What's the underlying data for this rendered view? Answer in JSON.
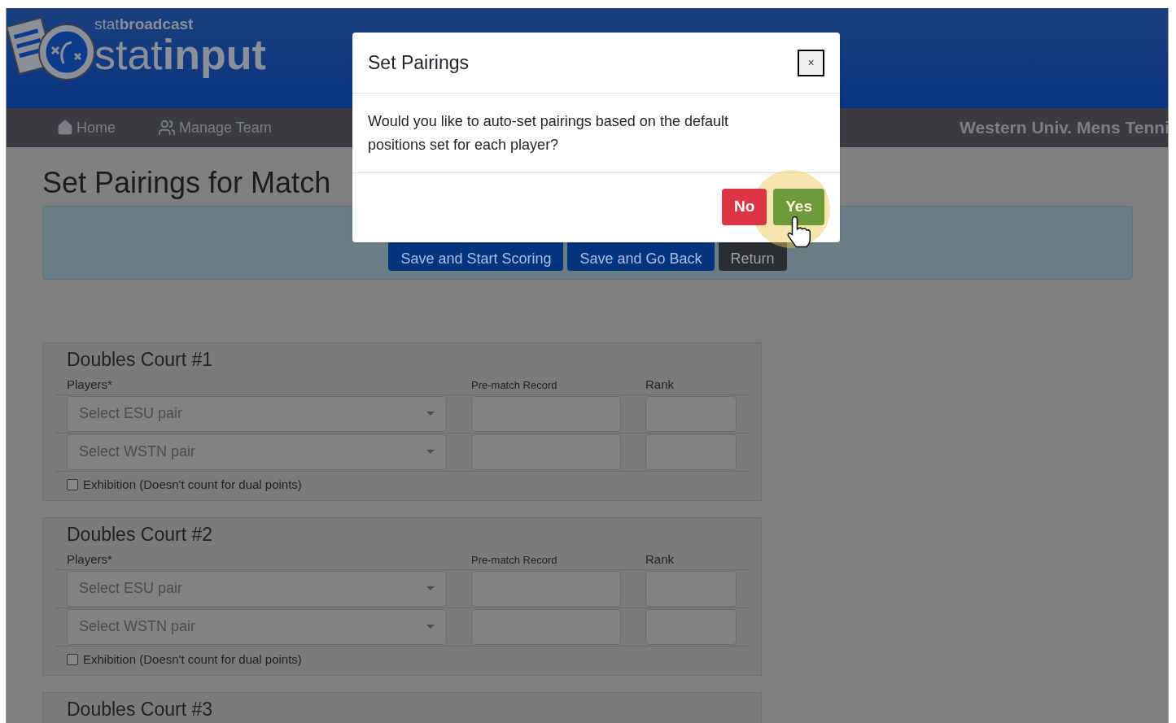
{
  "header": {
    "logo_small": "stat**broadcast**",
    "logo_big": "stat**input**"
  },
  "nav": {
    "items": [
      {
        "label": "Home",
        "kind": "home"
      },
      {
        "label": "Manage Team",
        "kind": "team"
      }
    ],
    "team_name": "Western Univ. Mens Tenni"
  },
  "page": {
    "title": "Set Pairings for Match",
    "actions": [
      {
        "label": "Save and Start Scoring",
        "kind": "primary"
      },
      {
        "label": "Save and Go Back",
        "kind": "primary"
      },
      {
        "label": "Return",
        "kind": "dark"
      }
    ]
  },
  "courts": [
    {
      "title": "Doubles Court #1",
      "players_label": "Players*",
      "record_label": "Pre-match Record",
      "rank_label": "Rank",
      "rows": [
        {
          "placeholder": "Select ESU pair"
        },
        {
          "placeholder": "Select WSTN pair"
        }
      ],
      "exhibition": {
        "label": "Exhibition (Doesn't count for dual points)",
        "checked": false
      }
    },
    {
      "title": "Doubles Court #2",
      "players_label": "Players*",
      "record_label": "Pre-match Record",
      "rank_label": "Rank",
      "rows": [
        {
          "placeholder": "Select ESU pair"
        },
        {
          "placeholder": "Select WSTN pair"
        }
      ],
      "exhibition": {
        "label": "Exhibition (Doesn't count for dual points)",
        "checked": false
      }
    },
    {
      "title": "Doubles Court #3"
    }
  ],
  "modal": {
    "title": "Set Pairings",
    "close": "×",
    "message": "Would you like to auto-set pairings based on the default positions set for each player?",
    "buttons": [
      {
        "label": "No",
        "kind": "danger"
      },
      {
        "label": "Yes",
        "kind": "success"
      }
    ]
  }
}
